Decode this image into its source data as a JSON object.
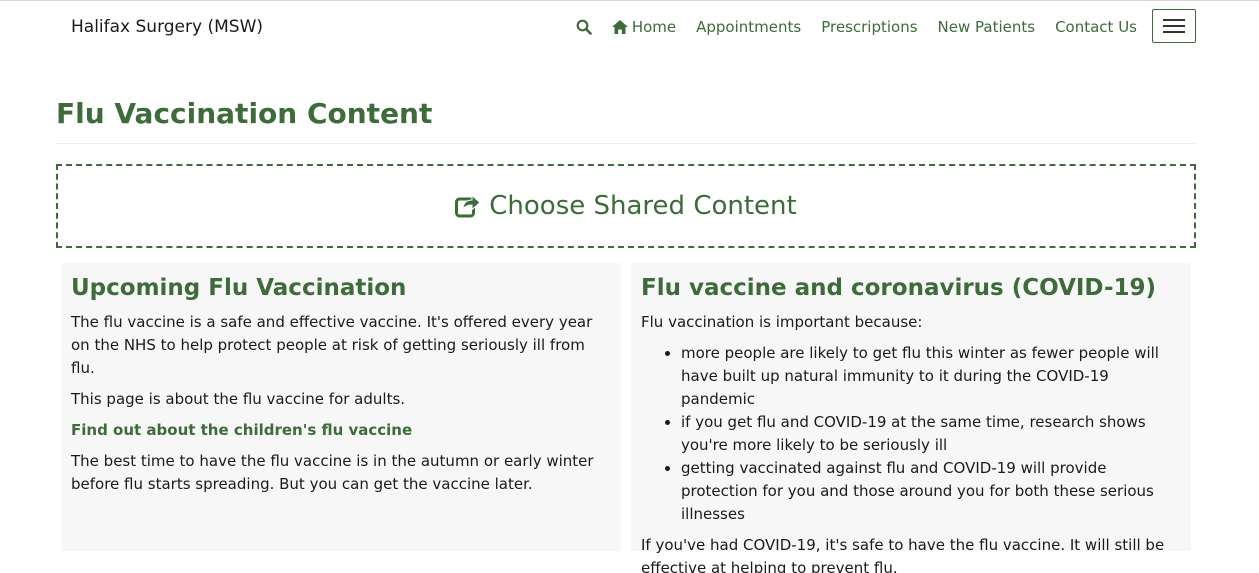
{
  "navbar": {
    "brand": "Halifax Surgery (MSW)",
    "links": [
      "Home",
      "Appointments",
      "Prescriptions",
      "New Patients",
      "Contact Us"
    ]
  },
  "page": {
    "title": "Flu Vaccination Content",
    "shared_content_label": "Choose Shared Content"
  },
  "left_panel": {
    "heading": "Upcoming Flu Vaccination",
    "p1": "The flu vaccine is a safe and effective vaccine. It's offered every year on the NHS to help protect people at risk of getting seriously ill from flu.",
    "p2": "This page is about the flu vaccine for adults.",
    "link": "Find out about the children's flu vaccine",
    "p3": "The best time to have the flu vaccine is in the autumn or early winter before flu starts spreading. But you can get the vaccine later."
  },
  "right_panel": {
    "heading": "Flu vaccine and coronavirus (COVID-19)",
    "intro": "Flu vaccination is important because:",
    "bullets": [
      "more people are likely to get flu this winter as fewer people will have built up natural immunity to it during the COVID-19 pandemic",
      "if you get flu and COVID-19 at the same time, research shows you're more likely to be seriously ill",
      "getting vaccinated against flu and COVID-19 will provide protection for you and those around you for both these serious illnesses"
    ],
    "outro": "If you've had COVID-19, it's safe to have the flu vaccine. It will still be effective at helping to prevent flu."
  },
  "colors": {
    "accent": "#3d6b3a",
    "panel_bg": "#f7f7f7"
  },
  "icons": [
    "search-icon",
    "home-icon",
    "share-icon",
    "menu-icon"
  ]
}
